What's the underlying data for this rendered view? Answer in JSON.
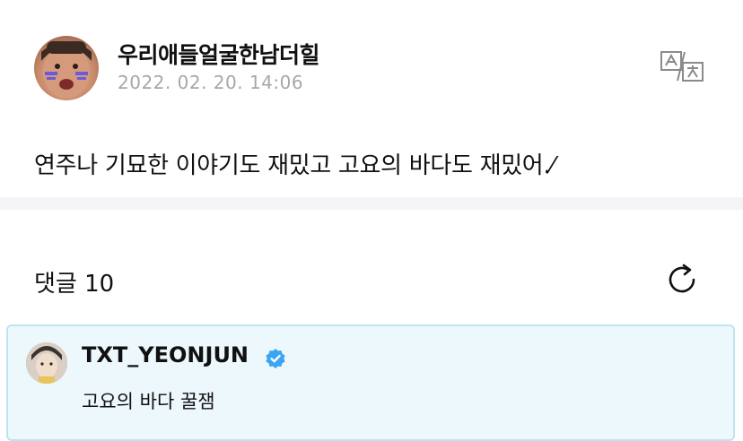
{
  "post": {
    "author": "우리애들얼굴한남더힐",
    "date": "2022. 02. 20. 14:06",
    "body": "연주나 기묘한 이야기도 재밌고 고요의 바다도 재밌어.⁄"
  },
  "comments": {
    "header": "댓글 10",
    "items": [
      {
        "author": "TXT_YEONJUN",
        "verified": true,
        "text": "고요의 바다 꿀잼"
      }
    ]
  },
  "icons": {
    "translate": "translate-icon",
    "refresh": "refresh-icon",
    "verified": "verified-badge-icon"
  },
  "colors": {
    "date_gray": "#a7a7a7",
    "highlight_bg": "#edf8fc",
    "highlight_border": "#bfe4f0",
    "verified_blue": "#3aa5f2"
  }
}
